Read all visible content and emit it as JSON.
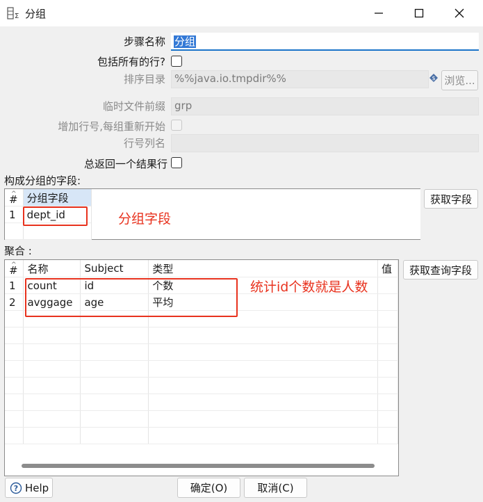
{
  "window": {
    "title": "分组",
    "icon": "table-sum-icon",
    "minimize_icon": "minimize-icon",
    "maximize_icon": "maximize-icon",
    "close_icon": "close-icon"
  },
  "form": {
    "step_name_label": "步骤名称",
    "step_name_value": "分组",
    "include_all_rows_label": "包括所有的行?",
    "include_all_rows_checked": false,
    "sort_dir_label": "排序目录",
    "sort_dir_value": "%%java.io.tmpdir%%",
    "browse_label": "浏览...",
    "temp_prefix_label": "临时文件前缀",
    "temp_prefix_value": "grp",
    "add_line_number_label": "增加行号,每组重新开始",
    "line_number_col_label": "行号列名",
    "line_number_col_value": "",
    "always_one_row_label": "总返回一个结果行",
    "always_one_row_checked": false
  },
  "group_fields": {
    "section_label": "构成分组的字段:",
    "columns": [
      "#",
      "分组字段"
    ],
    "rows": [
      [
        "1",
        "dept_id"
      ]
    ],
    "get_fields_label": "获取字段"
  },
  "aggregates": {
    "section_label": "聚合 :",
    "columns": [
      "#",
      "名称",
      "Subject",
      "类型",
      "值"
    ],
    "rows": [
      [
        "1",
        "count",
        "id",
        "个数",
        ""
      ],
      [
        "2",
        "avggage",
        "age",
        "平均",
        ""
      ]
    ],
    "get_lookup_fields_label": "获取查询字段"
  },
  "annotations": {
    "group_field_note": "分组字段",
    "aggregate_note": "统计id个数就是人数"
  },
  "footer": {
    "help_label": "Help",
    "ok_label": "确定(O)",
    "cancel_label": "取消(C)"
  },
  "colors": {
    "annotation": "#e8321e",
    "selection": "#3379d6",
    "header_highlight": "#d7e6f7"
  }
}
